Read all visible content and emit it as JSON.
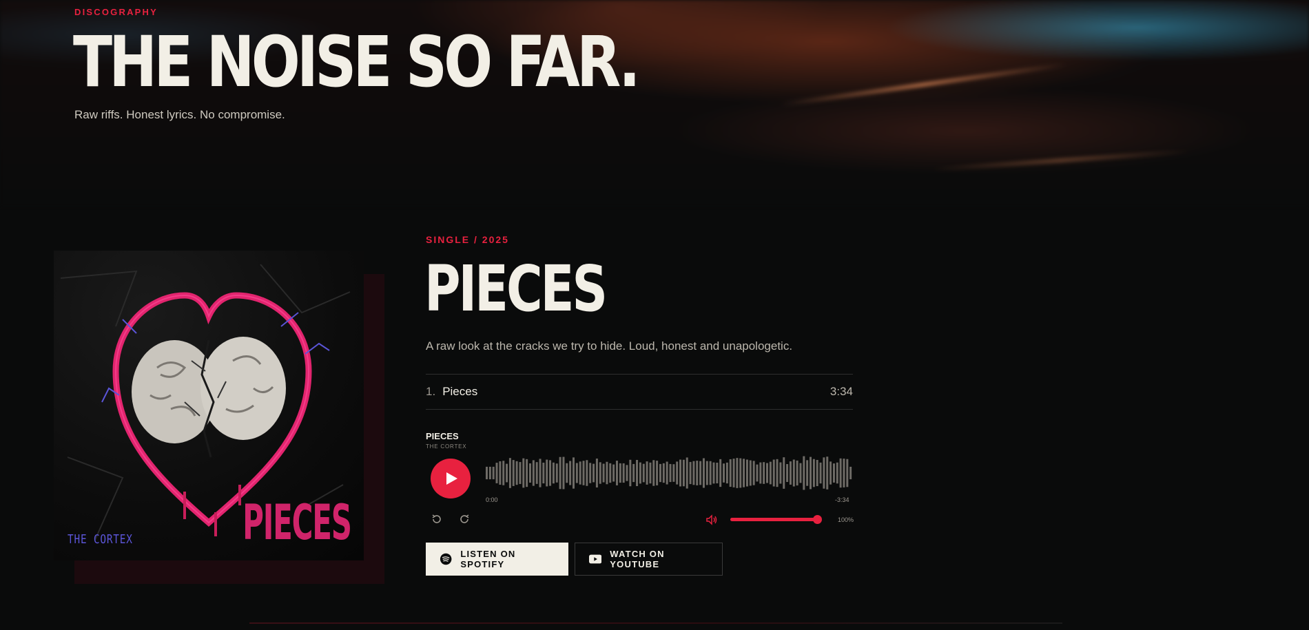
{
  "hero": {
    "eyebrow": "DISCOGRAPHY",
    "title": "THE NOISE SO FAR.",
    "subtitle": "Raw riffs. Honest lyrics. No compromise."
  },
  "release": {
    "tag": "SINGLE / 2025",
    "title": "PIECES",
    "description": "A raw look at the cracks we try to hide. Loud, honest and unapologetic.",
    "cover": {
      "band": "THE CORTEX",
      "title": "PIECES"
    },
    "tracks": [
      {
        "number": "1.",
        "name": "Pieces",
        "duration": "3:34"
      }
    ]
  },
  "player": {
    "title": "PIECES",
    "artist": "THE CORTEX",
    "time_current": "0:00",
    "time_remaining": "-3:34",
    "volume_label": "100%",
    "volume": 1.0,
    "progress": 0.0
  },
  "buttons": {
    "spotify": "LISTEN ON SPOTIFY",
    "youtube": "WATCH ON YOUTUBE"
  },
  "colors": {
    "accent": "#e8213f",
    "background": "#0a0b0b",
    "text": "#f2efe6"
  },
  "icons": {
    "play": "play-icon",
    "rewind": "rewind-icon",
    "forward": "forward-icon",
    "volume": "volume-icon",
    "spotify": "spotify-icon",
    "youtube": "youtube-icon"
  }
}
